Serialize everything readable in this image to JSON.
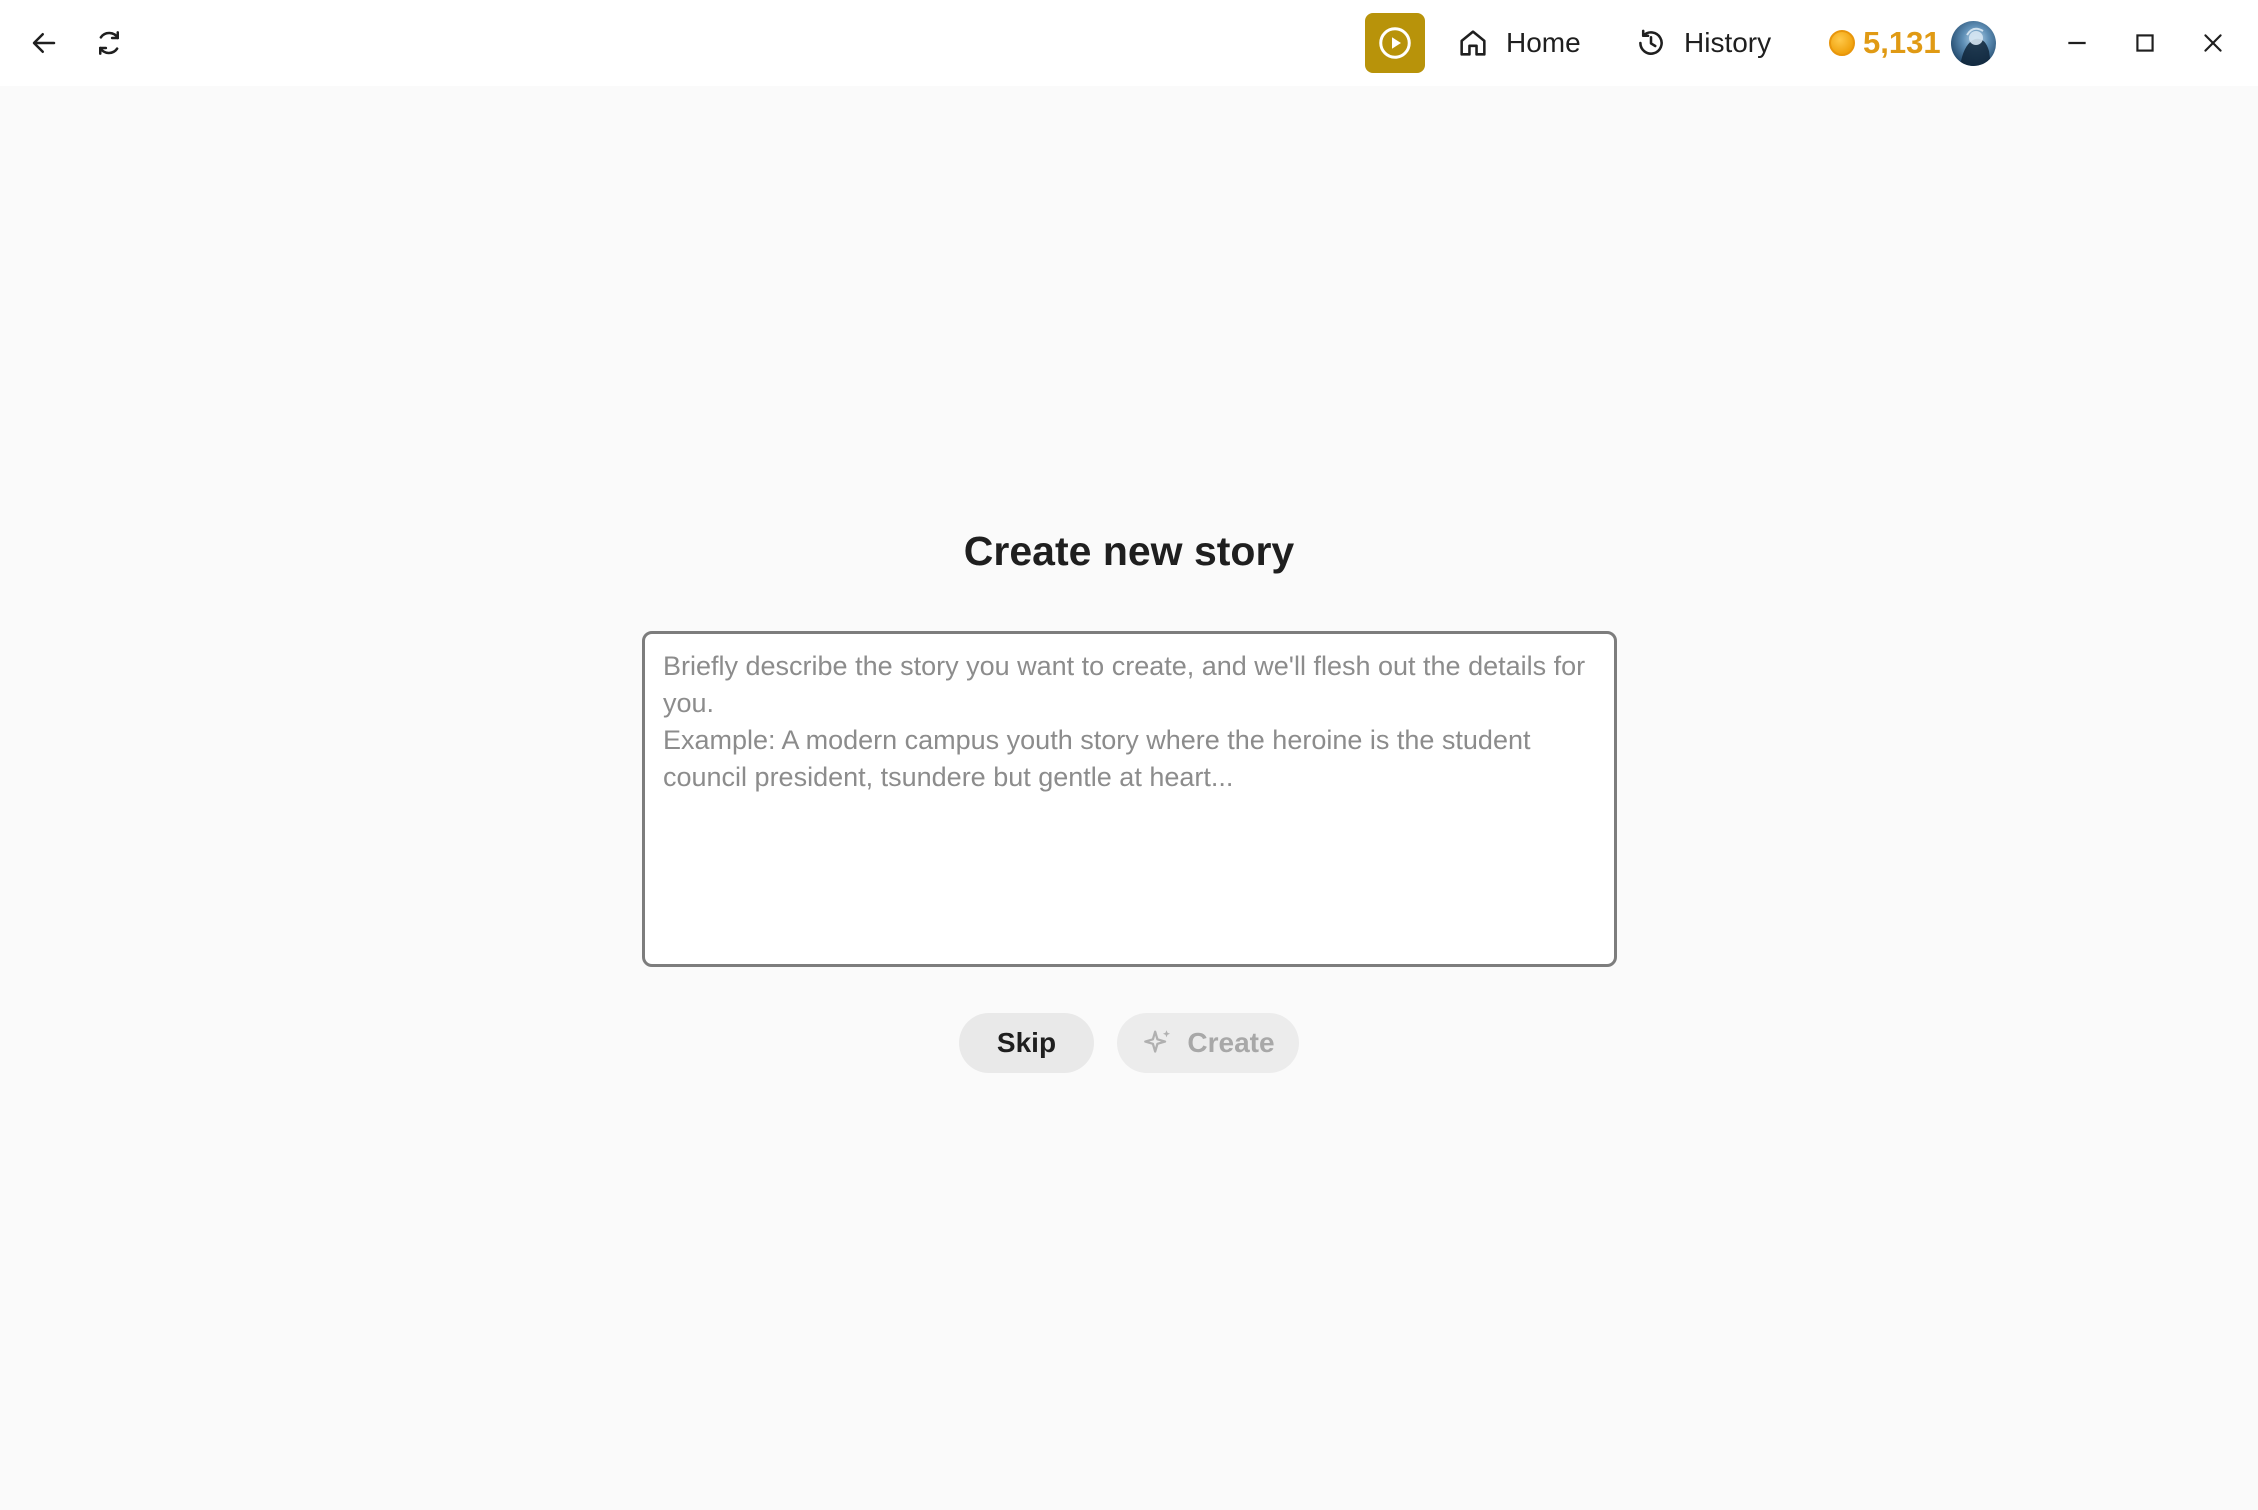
{
  "titlebar": {
    "nav": {
      "home_label": "Home",
      "history_label": "History"
    },
    "coins": "5,131"
  },
  "main": {
    "title": "Create new story",
    "story_input": {
      "value": "",
      "placeholder": "Briefly describe the story you want to create, and we'll flesh out the details for you.\nExample: A modern campus youth story where the heroine is the student council president, tsundere but gentle at heart..."
    },
    "skip_label": "Skip",
    "create_label": "Create"
  },
  "colors": {
    "accent": "#b8930a",
    "coin": "#e09a14",
    "background": "#fafafa"
  },
  "icons": [
    "back-arrow-icon",
    "refresh-icon",
    "play-icon",
    "home-icon",
    "history-icon",
    "coin-icon",
    "minimize-icon",
    "maximize-icon",
    "close-icon",
    "sparkle-icon"
  ]
}
